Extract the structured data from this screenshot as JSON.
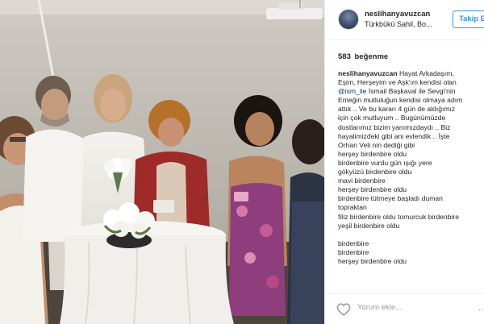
{
  "post": {
    "username": "neslihanyavuzcan",
    "location": "Türkbükü Sahil, Bo...",
    "follow_label": "Takip Et",
    "likes_count": "583",
    "likes_label": "beğenme",
    "caption": {
      "username": "neslihanyavuzcan",
      "lines": [
        "Hayat Arkadaşım,",
        "Eşim, Herşeyim ve Aşk'ım kendisi olan",
        "@ism_ile",
        "İsmail Başkaval ile Sevgi'nin",
        "Emeğin mutluluğun kendisi olmaya adım",
        "attık .. Ve bu kararı 4 gün de aldığımız",
        "için çok mutluyum .. Bugünümüzde",
        "dostlarımız bizim yanımızdaydı .. Biz",
        "hayalimizdeki gibi ani evlendik .. İşte",
        "Orhan Veli nin dediği gibi",
        "herşey birdenbire oldu",
        "birdenbire vurdu gün ışığı yere",
        "gökyüzü birdenbire oldu",
        "mavi birdenbire",
        "herşey birdenbire oldu",
        "birdenbire tütmeye başladı duman",
        "topraktan",
        "filiz birdenbire oldu tomurcuk birdenbire",
        "yeşil birdenbire oldu",
        "",
        "birdenbire",
        "birdenbire",
        "herşey birdenbire oldu"
      ]
    },
    "comment_placeholder": "Yorum ekle...",
    "more_label": "..."
  },
  "icons": {
    "avatar": "avatar",
    "heart": "heart-icon"
  },
  "colors": {
    "accent": "#3897f0",
    "text": "#262626",
    "mention": "#003569",
    "muted": "#999999"
  }
}
